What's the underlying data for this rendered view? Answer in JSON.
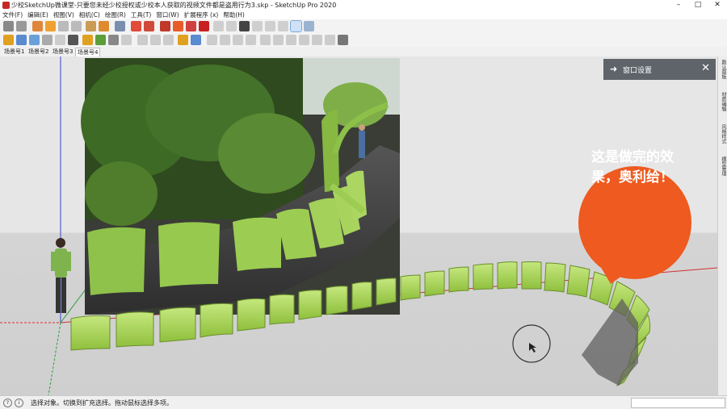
{
  "window": {
    "title": "少校SketchUp微课堂-只要您未经少校授权或少校本人获取的视频文件都是盗用行为3.skp - SketchUp Pro 2020",
    "minimize": "–",
    "maximize": "□",
    "close": "✕"
  },
  "menu": [
    "文件(F)",
    "编辑(E)",
    "视图(V)",
    "相机(C)",
    "绘图(R)",
    "工具(T)",
    "窗口(W)",
    "扩展程序 (x)",
    "帮助(H)"
  ],
  "scene_tabs": [
    "场景号1",
    "场景号2",
    "场景号3",
    "场景号4"
  ],
  "active_scene": "场景号4",
  "panel": {
    "window_settings_label": "窗口设置",
    "arrow": "➜",
    "close": "✕"
  },
  "right_tray_tabs": [
    "默认面板",
    "材质编辑",
    "风格样式",
    "模型管理"
  ],
  "callout": {
    "line1": "这是做完的效",
    "line2": "果，奥利给！",
    "color": "#ee5a1f"
  },
  "status": {
    "message": "选择对象。切换到扩充选择。拖动鼠标选择多项。",
    "help_icon": "?",
    "info_icon": "i"
  },
  "colors": {
    "bench_green": "#a6d15a",
    "bench_dark": "#6b8e2e",
    "red_axis": "#d32f2f",
    "blue_axis": "#3344cc",
    "green_axis": "#2e9c3c"
  }
}
